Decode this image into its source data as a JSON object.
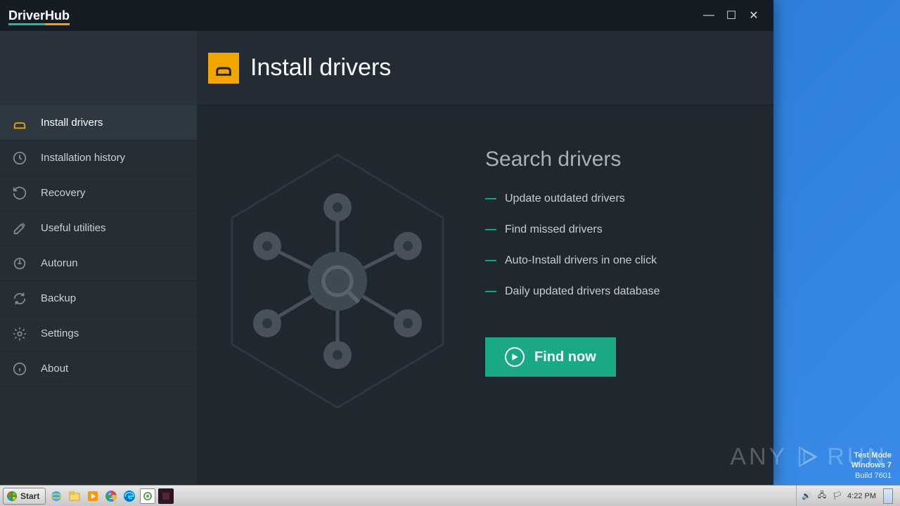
{
  "app": {
    "name": "DriverHub"
  },
  "window_controls": {
    "min": "—",
    "max": "☐",
    "close": "✕"
  },
  "sidebar": {
    "items": [
      {
        "label": "Install drivers",
        "icon": "install"
      },
      {
        "label": "Installation history",
        "icon": "clock"
      },
      {
        "label": "Recovery",
        "icon": "history"
      },
      {
        "label": "Useful utilities",
        "icon": "tools"
      },
      {
        "label": "Autorun",
        "icon": "power"
      },
      {
        "label": "Backup",
        "icon": "refresh"
      },
      {
        "label": "Settings",
        "icon": "gear"
      },
      {
        "label": "About",
        "icon": "info"
      }
    ]
  },
  "header": {
    "title": "Install drivers"
  },
  "main": {
    "title": "Search drivers",
    "features": [
      "Update outdated drivers",
      "Find missed drivers",
      "Auto-Install drivers in one click",
      "Daily updated drivers database"
    ],
    "cta": "Find now"
  },
  "desktop": {
    "test_mode": "Test Mode",
    "os": "Windows 7",
    "build": "Build 7601",
    "anyrun": "ANY     RUN"
  },
  "taskbar": {
    "start": "Start",
    "clock": "4:22 PM"
  }
}
